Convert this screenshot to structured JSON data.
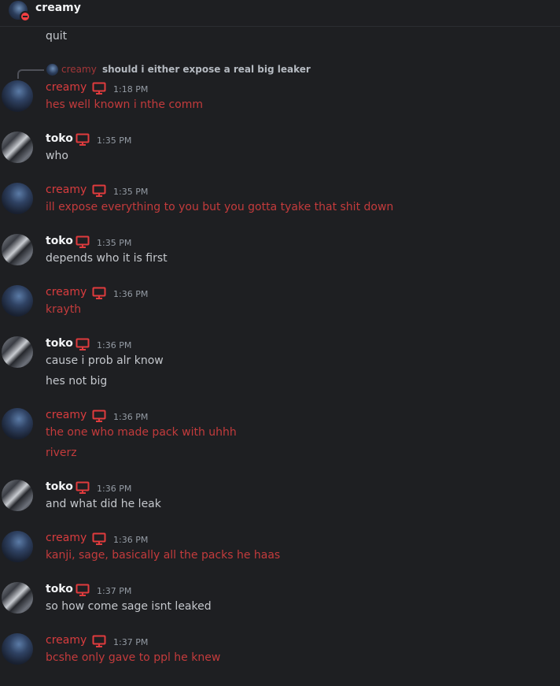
{
  "header": {
    "username": "creamy",
    "avatar_icon": "creamy-avatar",
    "status_icon": "do-not-disturb-icon"
  },
  "top_message": "quit",
  "reply": {
    "username": "creamy",
    "text": "should i either expose a real big leaker"
  },
  "colors": {
    "background": "#1e1f22",
    "creamy_name": "#d83c3e",
    "creamy_text": "#c33b3c",
    "toko_name": "#f2f3f5",
    "toko_text": "#c4c7cc",
    "timestamp": "#949ba4",
    "monitor_icon": "#e03b3d"
  },
  "groups": [
    {
      "user": "creamy",
      "time": "1:18 PM",
      "messages": [
        "hes well known i nthe comm"
      ]
    },
    {
      "user": "toko",
      "time": "1:35 PM",
      "messages": [
        "who"
      ]
    },
    {
      "user": "creamy",
      "time": "1:35 PM",
      "messages": [
        "ill expose everything to you but you gotta tyake that shit down"
      ]
    },
    {
      "user": "toko",
      "time": "1:35 PM",
      "messages": [
        "depends who it is first"
      ]
    },
    {
      "user": "creamy",
      "time": "1:36 PM",
      "messages": [
        "krayth"
      ]
    },
    {
      "user": "toko",
      "time": "1:36 PM",
      "messages": [
        "cause i prob alr know",
        "hes not big"
      ]
    },
    {
      "user": "creamy",
      "time": "1:36 PM",
      "messages": [
        "the one who made pack with uhhh",
        "riverz"
      ]
    },
    {
      "user": "toko",
      "time": "1:36 PM",
      "messages": [
        "and what did he leak"
      ]
    },
    {
      "user": "creamy",
      "time": "1:36 PM",
      "messages": [
        "kanji, sage, basically all the packs he haas"
      ]
    },
    {
      "user": "toko",
      "time": "1:37 PM",
      "messages": [
        "so how come sage isnt leaked"
      ]
    },
    {
      "user": "creamy",
      "time": "1:37 PM",
      "messages": [
        "bcshe only gave to ppl he knew"
      ]
    }
  ]
}
